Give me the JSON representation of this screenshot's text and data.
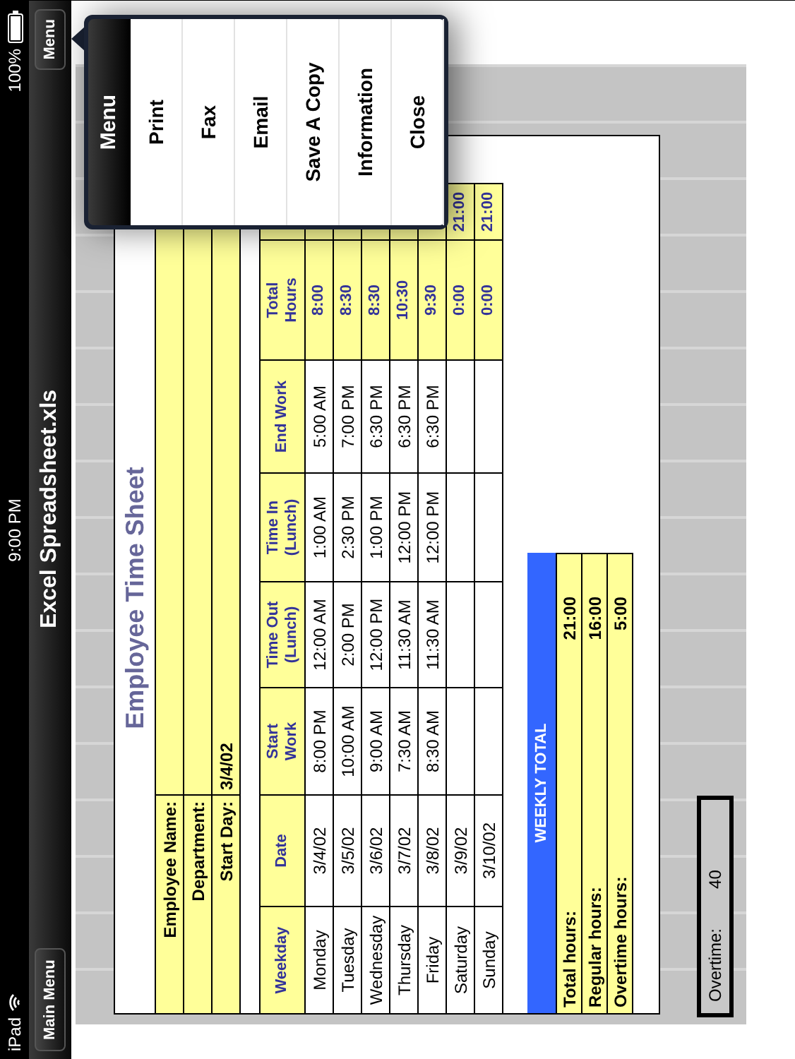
{
  "status_bar": {
    "device": "iPad",
    "time": "9:00 PM",
    "battery": "100%"
  },
  "nav_bar": {
    "back_button": "Main Menu",
    "title": "Excel Spreadsheet.xls",
    "menu_button": "Menu"
  },
  "sheet": {
    "title": "Employee Time Sheet",
    "fields": [
      {
        "label": "Employee Name:"
      },
      {
        "label": "Department:"
      },
      {
        "label": "Start Day:",
        "value": "3/4/02"
      }
    ],
    "columns": [
      "Weekday",
      "Date",
      "Start Work",
      "Time Out (Lunch)",
      "Time In (Lunch)",
      "End Work",
      "Total Hours"
    ],
    "rows": [
      {
        "weekday": "Monday",
        "date": "3/4/02",
        "start_work": "8:00 PM",
        "time_out": "12:00 AM",
        "time_in": "1:00 AM",
        "end_work": "5:00 AM",
        "total_hours": "8:00"
      },
      {
        "weekday": "Tuesday",
        "date": "3/5/02",
        "start_work": "10:00 AM",
        "time_out": "2:00 PM",
        "time_in": "2:30 PM",
        "end_work": "7:00 PM",
        "total_hours": "8:30"
      },
      {
        "weekday": "Wednesday",
        "date": "3/6/02",
        "start_work": "9:00 AM",
        "time_out": "12:00 PM",
        "time_in": "1:00 PM",
        "end_work": "6:30 PM",
        "total_hours": "8:30"
      },
      {
        "weekday": "Thursday",
        "date": "3/7/02",
        "start_work": "7:30 AM",
        "time_out": "11:30 AM",
        "time_in": "12:00 PM",
        "end_work": "6:30 PM",
        "total_hours": "10:30"
      },
      {
        "weekday": "Friday",
        "date": "3/8/02",
        "start_work": "8:30 AM",
        "time_out": "11:30 AM",
        "time_in": "12:00 PM",
        "end_work": "6:30 PM",
        "total_hours": "9:30"
      },
      {
        "weekday": "Saturday",
        "date": "3/9/02",
        "total_hours": "0:00",
        "column_8": "21:00"
      },
      {
        "weekday": "Sunday",
        "date": "3/10/02",
        "total_hours": "0:00",
        "column_8": "21:00"
      }
    ],
    "weekly_total": {
      "title": "WEEKLY TOTAL",
      "rows": [
        {
          "label": "Total hours:",
          "value": "21:00"
        },
        {
          "label": "Regular hours:",
          "value": "16:00"
        },
        {
          "label": "Overtime hours:",
          "value": "5:00"
        }
      ]
    }
  },
  "overtime": {
    "label": "Overtime:",
    "value": "40"
  },
  "popover": {
    "title": "Menu",
    "items": [
      "Print",
      "Fax",
      "Email",
      "Save A Copy",
      "Information",
      "Close"
    ]
  }
}
